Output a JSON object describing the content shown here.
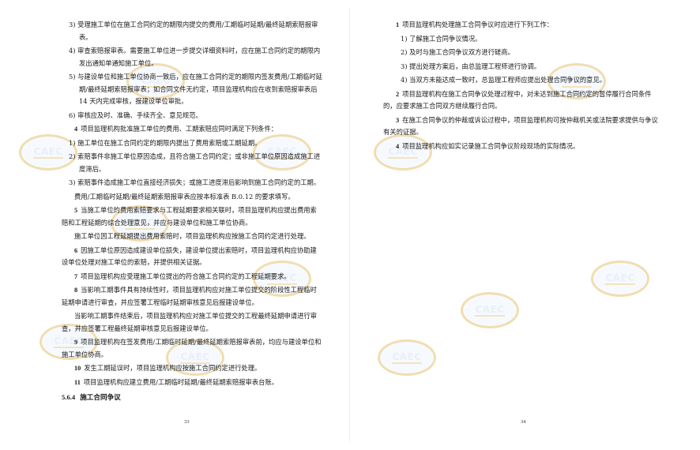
{
  "watermark_text": "CAEC",
  "left_page": {
    "paragraphs": [
      {
        "text": "3) 受理施工单位在施工合同约定的期限内提交的费用/工期临时延期/最终延期索赔报审表。",
        "style": "sub"
      },
      {
        "text": "4) 审查索赔报审表。需要施工单位进一步提交详细资料时，应在施工合同约定的期限内发出通知单通知施工单位。",
        "style": "sub"
      },
      {
        "text": "5) 与建设单位和施工单位协商一致后，应在施工合同约定的期限内签发费用/工期临时延期/最终延期索赔报审表；如合同文件无约定，项目监理机构应在收到索赔报审表后 14 天内完成审核，报建设单位审批。",
        "style": "sub"
      },
      {
        "text": "6) 审核应及时、准确、手续齐全、意见规范。",
        "style": "sub"
      },
      {
        "num": "4",
        "text": "项目监理机构批准施工单位的费用、工期索赔应同时满足下列条件：",
        "style": "item"
      },
      {
        "text": "1) 施工单位在施工合同约定的期限内提出了费用索赔或工期延期。",
        "style": "sub"
      },
      {
        "text": "2) 索赔事件非施工单位原因造成，且符合施工合同约定；或非施工单位原因造成施工进度滞后。",
        "style": "sub"
      },
      {
        "text": "3) 索赔事件造成施工单位直接经济损失；或施工进度滞后影响到施工合同约定的工期。",
        "style": "sub"
      },
      {
        "text": "费用/工期临时延期/最终延期索赔报审表应按本标准表 B.0.12 的要求填写。",
        "style": "item"
      },
      {
        "num": "5",
        "text": "当施工单位的费用索赔要求与工程延期要求相关联时，项目监理机构应提出费用索赔和工程延期的综合处理意见，并应与建设单位和施工单位协商。",
        "style": "item"
      },
      {
        "text": "施工单位因工程延期提出费用索赔时，项目监理机构应按施工合同约定进行处理。",
        "style": "item"
      },
      {
        "num": "6",
        "text": "因施工单位原因造成建设单位损失，建设单位提出索赔时，项目监理机构应协助建设单位处理对施工单位的索赔，并提供相关证据。",
        "style": "item"
      },
      {
        "num": "7",
        "text": "项目监理机构应受理施工单位提出的符合施工合同约定的工程延期要求。",
        "style": "item"
      },
      {
        "num": "8",
        "text": "当影响工期事件具有持续性时，项目监理机构应对施工单位提交的阶段性工程临时延期申请进行审查，并应签署工程临时延期审核意见后报建设单位。",
        "style": "item"
      },
      {
        "text": "当影响工期事件结束后，项目监理机构应对施工单位提交的工程最终延期申请进行审查，并应签署工程最终延期审核意见后报建设单位。",
        "style": "item"
      },
      {
        "num": "9",
        "text": "项目监理机构在签发费用/工期临时延期/最终延期索赔报审表前，均应与建设单位和施工单位协商。",
        "style": "item"
      },
      {
        "num": "10",
        "text": "发生工期延误时，项目监理机构应按施工合同约定进行处理。",
        "style": "item"
      },
      {
        "num": "11",
        "text": "项目监理机构应建立费用/工期临时延期/最终延期索赔报审表台账。",
        "style": "item"
      }
    ],
    "section_heading": {
      "num": "5.6.4",
      "title": "施工合同争议"
    },
    "page_number": "33"
  },
  "right_page": {
    "paragraphs": [
      {
        "num": "1",
        "text": "项目监理机构处理施工合同争议时应进行下列工作：",
        "style": "item"
      },
      {
        "text": "1) 了解施工合同争议情况。",
        "style": "sub-r"
      },
      {
        "text": "2) 及时与施工合同争议双方进行磋商。",
        "style": "sub-r"
      },
      {
        "text": "3) 提出处理方案后，由总监理工程师进行协调。",
        "style": "sub-r"
      },
      {
        "text": "4) 当双方未能达成一致时，总监理工程师应提出处理合同争议的意见。",
        "style": "sub-r"
      },
      {
        "num": "2",
        "text": "项目监理机构在施工合同争议处理过程中，对未达到施工合同约定的暂停履行合同条件的，应要求施工合同双方继续履行合同。",
        "style": "item"
      },
      {
        "num": "3",
        "text": "在施工合同争议的仲裁或诉讼过程中，项目监理机构可按仲裁机关或法院要求提供与争议有关的证据。",
        "style": "item"
      },
      {
        "num": "4",
        "text": "项目监理机构应如实记录施工合同争议阶段现场的实际情况。",
        "style": "item"
      }
    ],
    "page_number": "34"
  }
}
